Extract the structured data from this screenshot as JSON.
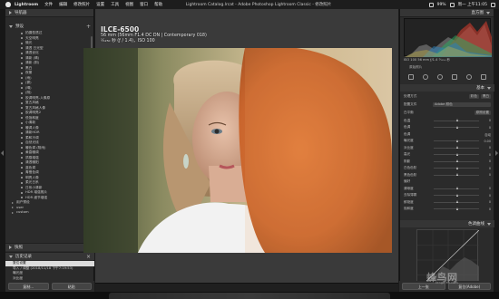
{
  "menubar": {
    "app": "Lightroom",
    "items": [
      "文件",
      "编辑",
      "修改照片",
      "设置",
      "工具",
      "视图",
      "窗口",
      "帮助"
    ],
    "title": "Lightroom Catalog.lrcat - Adobe Photoshop Lightroom Classic - 修改照片",
    "battery": "99%",
    "clock": "周一 上午11:05"
  },
  "left_panel": {
    "navigator_label": "导航器",
    "presets_label": "预设",
    "presets": [
      {
        "label": "拍摄型透过",
        "type": "item"
      },
      {
        "label": "天空明亮",
        "type": "item"
      },
      {
        "label": "微光",
        "type": "item"
      },
      {
        "label": "清透 日光型",
        "type": "item"
      },
      {
        "label": "清透优化",
        "type": "item"
      },
      {
        "label": "清新 (晴)",
        "type": "item"
      },
      {
        "label": "清新 (阴)",
        "type": "item"
      },
      {
        "label": "黑白",
        "type": "item"
      },
      {
        "label": "夜景",
        "type": "item"
      },
      {
        "label": "(雨)",
        "type": "item"
      },
      {
        "label": "(雾)",
        "type": "item"
      },
      {
        "label": "(晴)",
        "type": "item"
      },
      {
        "label": "(阴)",
        "type": "item"
      },
      {
        "label": "胶调明亮-人像原",
        "type": "item"
      },
      {
        "label": "复古风格",
        "type": "item"
      },
      {
        "label": "复古风格人像",
        "type": "item"
      },
      {
        "label": "胶调明亮2",
        "type": "item"
      },
      {
        "label": "低饱和度",
        "type": "item"
      },
      {
        "label": "小清新",
        "type": "item"
      },
      {
        "label": "暖调人像",
        "type": "item"
      },
      {
        "label": "清新HDR",
        "type": "item"
      },
      {
        "label": "柔和冷调",
        "type": "item"
      },
      {
        "label": "自然光线",
        "type": "item"
      },
      {
        "label": "暖色调 (阴雨)",
        "type": "item"
      },
      {
        "label": "黄昏暖调",
        "type": "item"
      },
      {
        "label": "质感增强",
        "type": "item"
      },
      {
        "label": "清透暖阳",
        "type": "item"
      },
      {
        "label": "蓝色调",
        "type": "item"
      },
      {
        "label": "青橙色调",
        "type": "item"
      },
      {
        "label": "明亮人像",
        "type": "item"
      },
      {
        "label": "柔光日系",
        "type": "item"
      },
      {
        "label": "日系小清新",
        "type": "item"
      },
      {
        "label": "HDR 增强照片",
        "type": "item"
      },
      {
        "label": "HDR 细节增强",
        "type": "item"
      },
      {
        "label": "用户预设",
        "type": "folder"
      },
      {
        "label": "user",
        "type": "folder"
      },
      {
        "label": "custom",
        "type": "folder"
      }
    ],
    "snapshots_label": "快照",
    "history_label": "历史记录",
    "history": [
      {
        "label": "复位设置",
        "sel": true
      },
      {
        "label": "导入 / 调整 (2018/11/18 下午7:19:53)",
        "sel": false
      },
      {
        "label": "曝光度",
        "sel": false
      },
      {
        "label": "对比度",
        "sel": false
      }
    ],
    "copy_button": "复制...",
    "paste_button": "粘贴"
  },
  "photo_info": {
    "model": "ILCE-6500",
    "lens": "56 mm (56mm F1.4 DC DN | Contemporary 018)",
    "exposure": "¹⁄₁₂₅₀ 秒 (ƒ / 1.4)，ISO 100"
  },
  "right_panel": {
    "histogram_label": "直方图",
    "readout": "ISO 100   56 mm   ƒ/1.4   ¹⁄₁₂₅₀ 秒",
    "original_photo": "原始照片",
    "basic_label": "基本",
    "treatment_label": "处理方式",
    "treatment_color": "彩色",
    "treatment_bw": "黑白",
    "profile_label": "配置文件",
    "profile_value": "Adobe 颜色",
    "wb_label": "白平衡",
    "wb_value": "原照设置",
    "sliders": [
      {
        "label": "色温",
        "value": "0",
        "pos": 0.5
      },
      {
        "label": "色调",
        "value": "0",
        "pos": 0.5
      },
      {
        "label": "色调",
        "value": "自动",
        "pos": null
      },
      {
        "label": "曝光度",
        "value": "0.00",
        "pos": 0.5
      },
      {
        "label": "对比度",
        "value": "0",
        "pos": 0.5
      },
      {
        "label": "高光",
        "value": "0",
        "pos": 0.5
      },
      {
        "label": "阴影",
        "value": "0",
        "pos": 0.5
      },
      {
        "label": "白色色阶",
        "value": "0",
        "pos": 0.5
      },
      {
        "label": "黑色色阶",
        "value": "0",
        "pos": 0.5
      },
      {
        "label": "偏好",
        "value": "",
        "pos": null
      },
      {
        "label": "清晰度",
        "value": "0",
        "pos": 0.5
      },
      {
        "label": "去除薄雾",
        "value": "0",
        "pos": 0.5
      },
      {
        "label": "鲜艳度",
        "value": "0",
        "pos": 0.5
      },
      {
        "label": "饱和度",
        "value": "0",
        "pos": 0.5
      }
    ],
    "tone_curve_label": "色调曲线",
    "prev_button": "上一张",
    "reset_button": "复位(Adobe)"
  },
  "watermark": {
    "text": "蜂鸟网",
    "sub": "fengniao.com"
  }
}
